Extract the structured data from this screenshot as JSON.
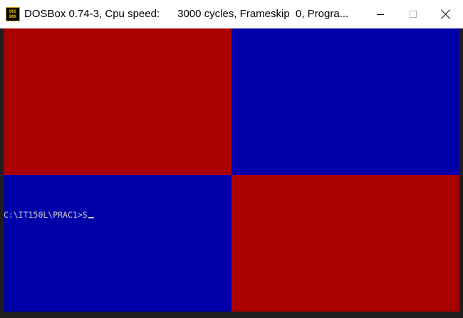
{
  "window": {
    "title": "DOSBox 0.74-3, Cpu speed:      3000 cycles, Frameskip  0, Progra...",
    "icon": "dosbox-icon",
    "icon_text": [
      "DOS",
      "BOX"
    ],
    "controls": [
      "minimize-icon",
      "maximize-icon",
      "close-icon"
    ]
  },
  "screen": {
    "colors": {
      "top_left": "#aa0000",
      "top_right": "#0000aa",
      "bottom_left": "#0000aa",
      "bottom_right": "#aa0000",
      "text": "#c8c8c8"
    },
    "prompt": "C:\\IT150L\\PRAC1>S"
  }
}
